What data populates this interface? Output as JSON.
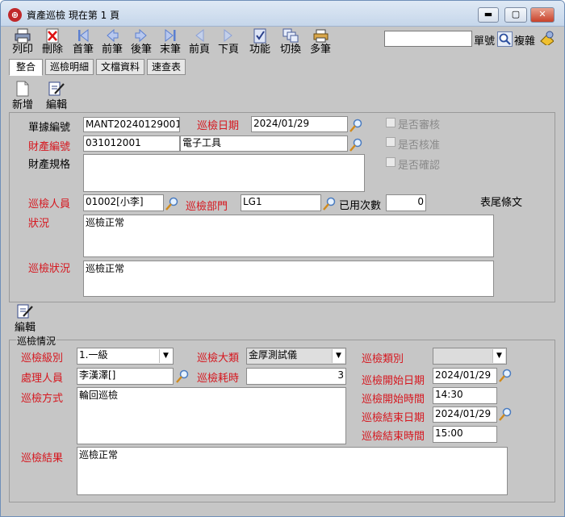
{
  "window": {
    "title": "資產巡檢  現在第 1 頁",
    "app_icon_glyph": "⊕",
    "minimize": "▬",
    "maximize": "▢",
    "close": "✕"
  },
  "toolbar": {
    "print": "列印",
    "delete": "刪除",
    "first": "首筆",
    "prev": "前筆",
    "next": "後筆",
    "last": "末筆",
    "prev_page": "前頁",
    "next_page": "下頁",
    "function": "功能",
    "switch": "切換",
    "multi": "多筆"
  },
  "search": {
    "label_doc": "單號",
    "label_copy": "複雜",
    "value": ""
  },
  "tabs": [
    "整合",
    "巡檢明細",
    "文檔資料",
    "速查表"
  ],
  "actions": {
    "add": "新增",
    "edit": "編輯",
    "edit2": "編輯"
  },
  "form": {
    "doc_no_label": "單據編號",
    "doc_no": "MANT20240129001",
    "inspect_date_label": "巡檢日期",
    "inspect_date": "2024/01/29",
    "asset_no_label": "財產編號",
    "asset_no": "031012001",
    "asset_name": "電子工具",
    "asset_spec_label": "財產規格",
    "asset_spec": "",
    "reviewed": "是否審核",
    "approved": "是否核准",
    "confirmed": "是否確認",
    "inspector_label": "巡檢人員",
    "inspector": "01002[小李]",
    "dept_label": "巡檢部門",
    "dept": "LG1",
    "used_count_label": "已用次數",
    "used_count": "0",
    "footer_text": "表尾條文",
    "status_label": "狀況",
    "status": "巡檢正常",
    "inspect_status_label": "巡檢狀況",
    "inspect_status": "巡檢正常"
  },
  "detail": {
    "group_title": "巡檢情況",
    "level_label": "巡檢級別",
    "level": "1.一級",
    "category_label": "巡檢大類",
    "category": "金厚測試儀",
    "type_label": "巡檢類別",
    "type": "",
    "handler_label": "處理人員",
    "handler": "李漢澤[]",
    "duration_label": "巡檢耗時",
    "duration": "3",
    "start_date_label": "巡檢開始日期",
    "start_date": "2024/01/29",
    "method_label": "巡檢方式",
    "method": "輪回巡檢",
    "start_time_label": "巡檢開始時間",
    "start_time": "14:30",
    "end_date_label": "巡檢結束日期",
    "end_date": "2024/01/29",
    "end_time_label": "巡檢結束時間",
    "end_time": "15:00",
    "result_label": "巡檢結果",
    "result": "巡檢正常"
  }
}
